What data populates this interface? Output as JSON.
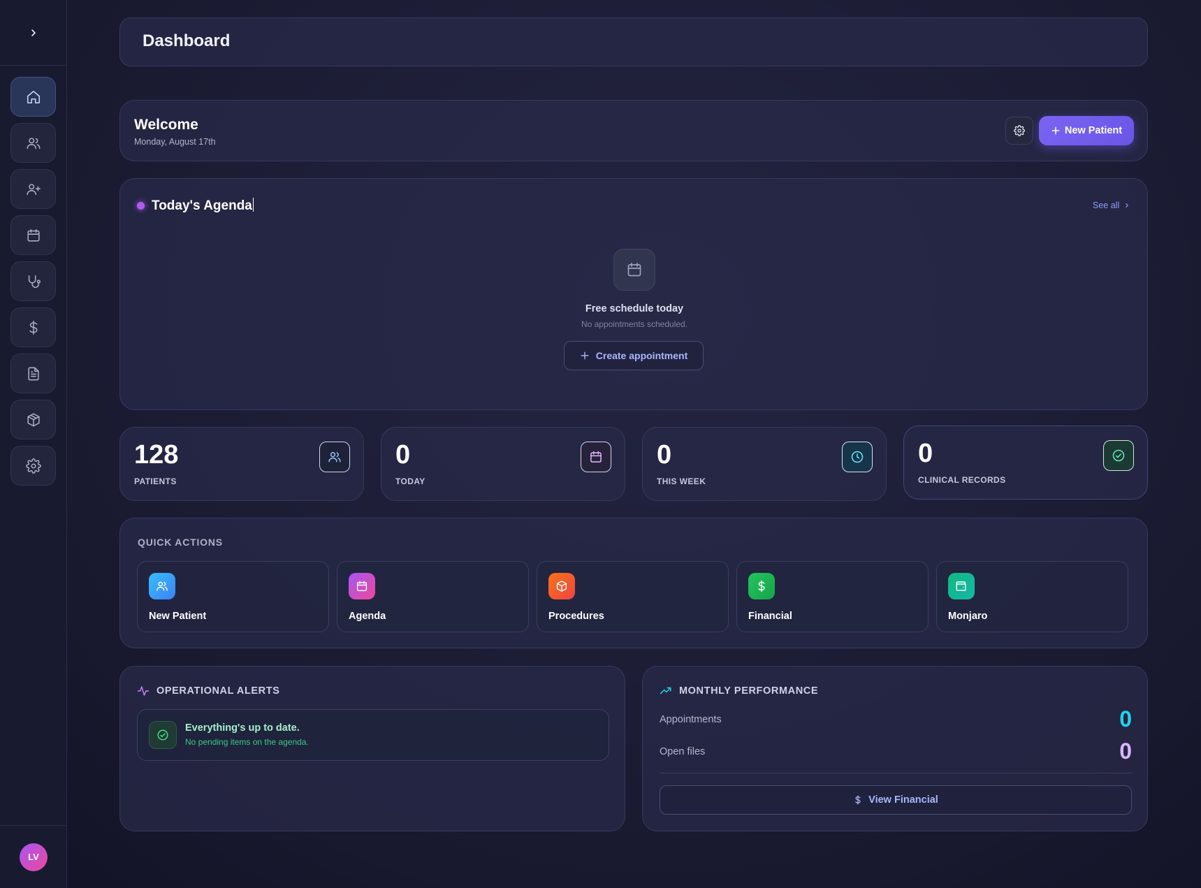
{
  "header": {
    "title": "Dashboard"
  },
  "welcome": {
    "title": "Welcome",
    "date": "Monday, August 17th",
    "new_patient_label": "New Patient"
  },
  "agenda": {
    "title": "Today's Agenda",
    "see_all": "See all",
    "empty_title": "Free schedule today",
    "empty_subtitle": "No appointments scheduled.",
    "create_label": "Create appointment"
  },
  "stats": [
    {
      "value": "128",
      "label": "PATIENTS",
      "icon": "users-icon"
    },
    {
      "value": "0",
      "label": "TODAY",
      "icon": "calendar-icon"
    },
    {
      "value": "0",
      "label": "THIS WEEK",
      "icon": "clock-icon"
    },
    {
      "value": "0",
      "label": "CLINICAL RECORDS",
      "icon": "check-circle-icon"
    }
  ],
  "quick_actions": {
    "title": "QUICK ACTIONS",
    "items": [
      {
        "label": "New Patient",
        "icon": "users-icon",
        "color": "#3b82f6"
      },
      {
        "label": "Agenda",
        "icon": "calendar-icon",
        "color": "#c04fd8"
      },
      {
        "label": "Procedures",
        "icon": "box-icon",
        "color": "#f26b2a"
      },
      {
        "label": "Financial",
        "icon": "dollar-icon",
        "color": "#22b55e"
      },
      {
        "label": "Monjaro",
        "icon": "wallet-icon",
        "color": "#14b88a"
      }
    ]
  },
  "alerts": {
    "title": "OPERATIONAL ALERTS",
    "status_title": "Everything's up to date.",
    "status_subtitle": "No pending items on the agenda."
  },
  "performance": {
    "title": "MONTHLY PERFORMANCE",
    "rows": [
      {
        "label": "Appointments",
        "value": "0",
        "color": "#22d3ee"
      },
      {
        "label": "Open files",
        "value": "0",
        "color": "#d8b4fe"
      }
    ],
    "button_label": "View Financial"
  },
  "user": {
    "initials": "LV"
  },
  "colors": {
    "accent": "#7b64f2",
    "background": "#1b1b33"
  }
}
